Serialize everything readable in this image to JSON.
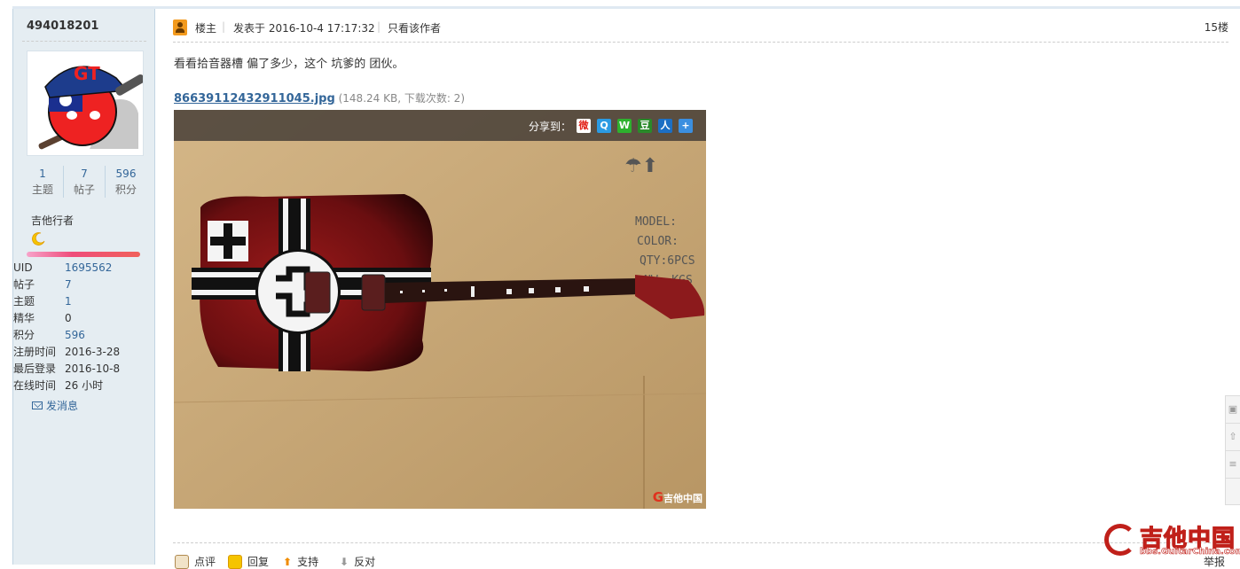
{
  "user": {
    "name": "494018201",
    "stats": [
      {
        "value": "1",
        "label": "主题"
      },
      {
        "value": "7",
        "label": "帖子"
      },
      {
        "value": "596",
        "label": "积分"
      }
    ],
    "group": "吉他行者",
    "info": [
      {
        "key": "UID",
        "value": "1695562"
      },
      {
        "key": "帖子",
        "value": "7"
      },
      {
        "key": "主题",
        "value": "1"
      },
      {
        "key": "精华",
        "value": "0"
      },
      {
        "key": "积分",
        "value": "596"
      },
      {
        "key": "注册时间",
        "value": "2016-3-28"
      },
      {
        "key": "最后登录",
        "value": "2016-10-8"
      },
      {
        "key": "在线时间",
        "value": "26 小时"
      }
    ],
    "send_message": "发消息"
  },
  "post": {
    "author_role": "楼主",
    "posted_at": "发表于 2016-10-4 17:17:32",
    "only_author": "只看该作者",
    "floor": "15楼",
    "content": "看看拾音器槽 偏了多少，这个 坑爹的 团伙。",
    "attachment": {
      "filename": "86639112432911045.jpg",
      "meta": "(148.24 KB, 下载次数: 2)"
    },
    "share_label": "分享到：",
    "share_icons": [
      "weibo-icon",
      "qzone-icon",
      "wechat-icon",
      "douban-icon",
      "renren-icon",
      "more-share-icon"
    ],
    "watermark": "吉他中国",
    "watermark_url": "bbs.GuitarChina.com"
  },
  "actions": {
    "comment": "点评",
    "reply": "回复",
    "support": "支持",
    "oppose": "反对",
    "report": "举报"
  },
  "site_logo": {
    "name": "吉他中国",
    "url": "bbs.GuitarChina.com"
  },
  "colors": {
    "link": "#336699",
    "sidebar_bg": "#e5edf2",
    "brand_red": "#c0201a"
  }
}
